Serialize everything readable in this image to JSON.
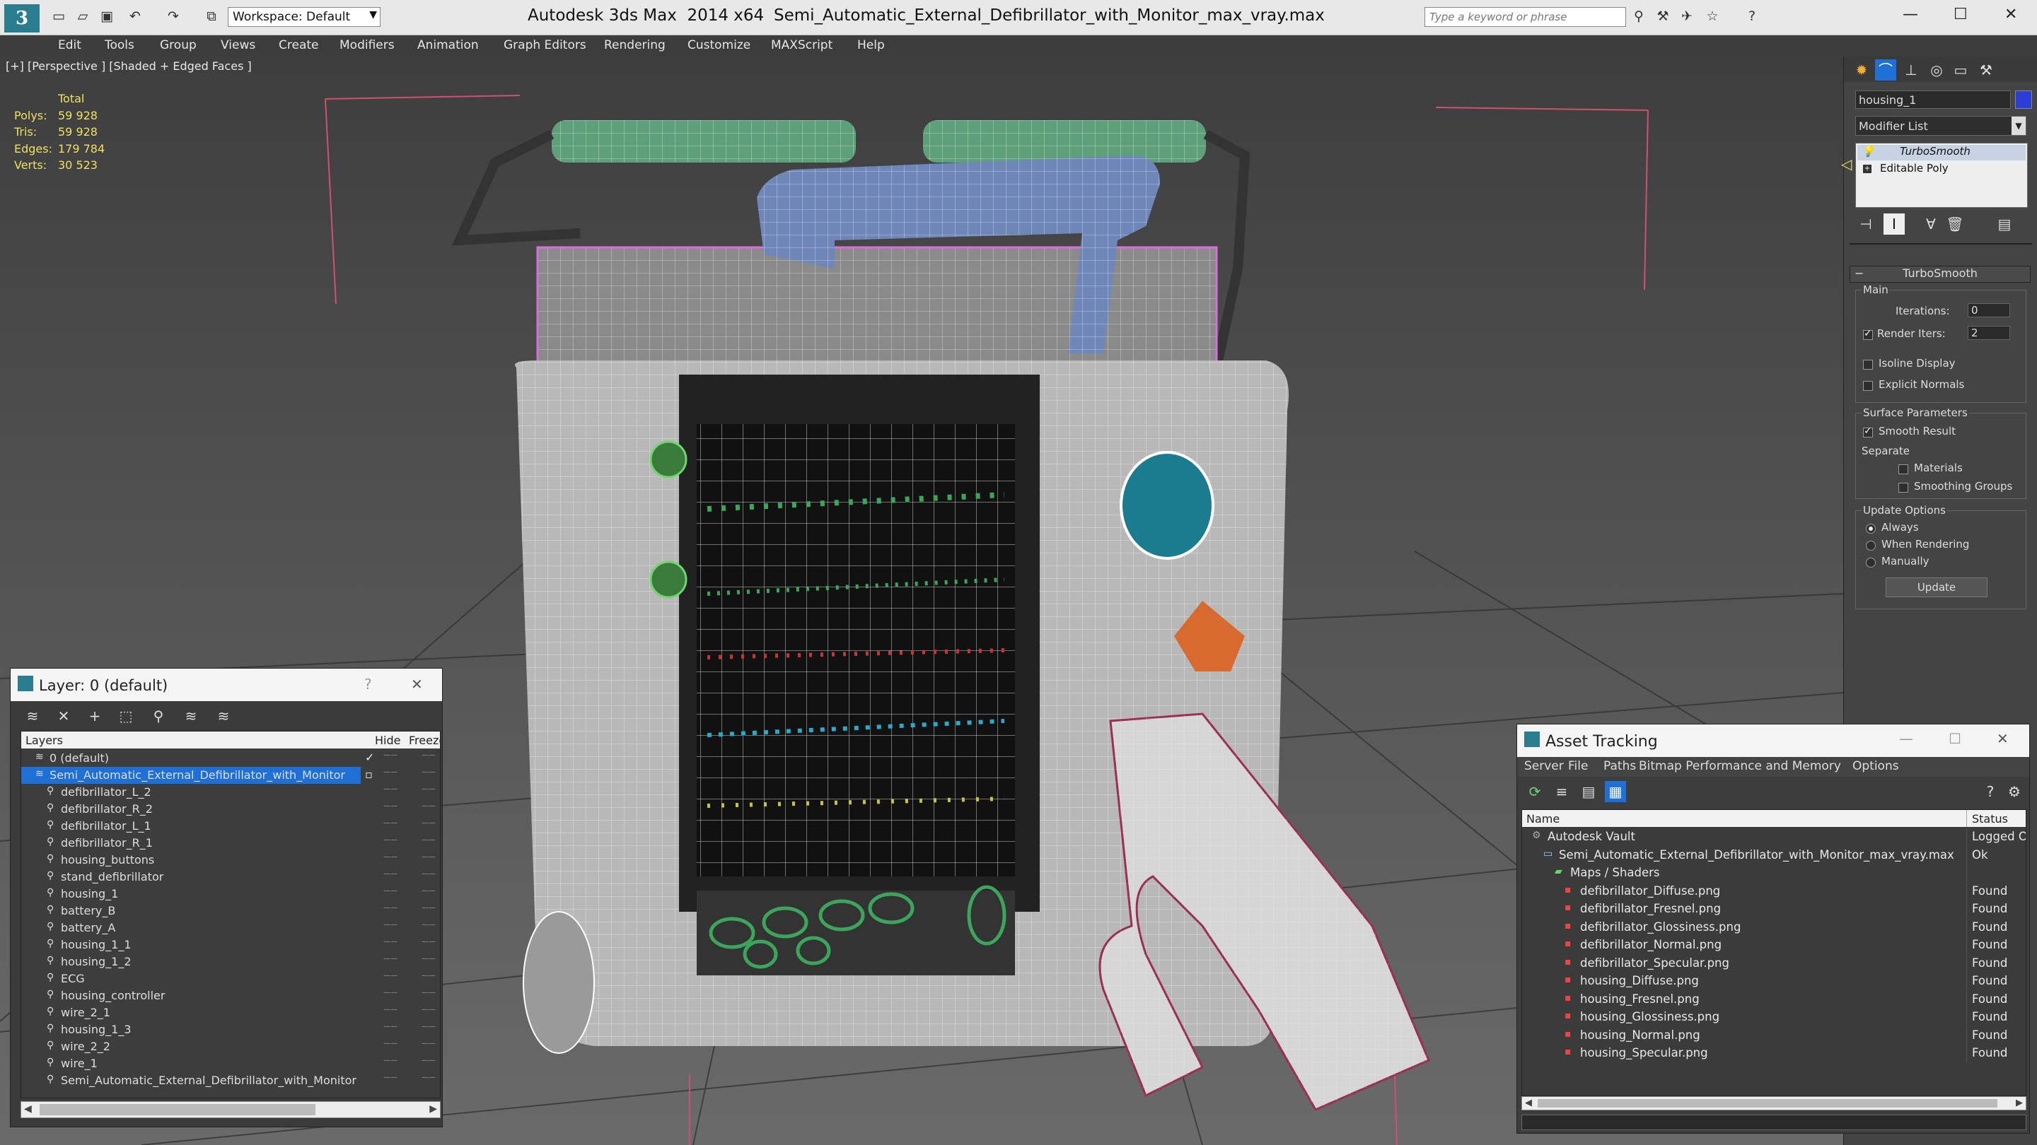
{
  "titlebar": {
    "app_title": "Autodesk 3ds Max  2014 x64",
    "file_name": "Semi_Automatic_External_Defibrillator_with_Monitor_max_vray.max",
    "workspace": "Workspace: Default",
    "search_placeholder": "Type a keyword or phrase"
  },
  "menu": [
    "Edit",
    "Tools",
    "Group",
    "Views",
    "Create",
    "Modifiers",
    "Animation",
    "Graph Editors",
    "Rendering",
    "Customize",
    "MAXScript",
    "Help"
  ],
  "viewport": {
    "label": "[+] [Perspective ] [Shaded + Edged Faces ]",
    "stats": {
      "header": "Total",
      "polys_label": "Polys:",
      "polys": "59 928",
      "tris_label": "Tris:",
      "tris": "59 928",
      "edges_label": "Edges:",
      "edges": "179 784",
      "verts_label": "Verts:",
      "verts": "30 523"
    }
  },
  "layer_panel": {
    "title": "Layer: 0 (default)",
    "help": "?",
    "close": "✕",
    "col_layers": "Layers",
    "col_hide": "Hide",
    "col_freeze": "Freeze",
    "layers": [
      {
        "name": "0 (default)",
        "level": 1
      },
      {
        "name": "Semi_Automatic_External_Defibrillator_with_Monitor",
        "level": 1
      },
      {
        "name": "defibrillator_L_2",
        "level": 2
      },
      {
        "name": "defibrillator_R_2",
        "level": 2
      },
      {
        "name": "defibrillator_L_1",
        "level": 2
      },
      {
        "name": "defibrillator_R_1",
        "level": 2
      },
      {
        "name": "housing_buttons",
        "level": 2
      },
      {
        "name": "stand_defibrillator",
        "level": 2
      },
      {
        "name": "housing_1",
        "level": 2
      },
      {
        "name": "battery_B",
        "level": 2
      },
      {
        "name": "battery_A",
        "level": 2
      },
      {
        "name": "housing_1_1",
        "level": 2
      },
      {
        "name": "housing_1_2",
        "level": 2
      },
      {
        "name": "ECG",
        "level": 2
      },
      {
        "name": "housing_controller",
        "level": 2
      },
      {
        "name": "wire_2_1",
        "level": 2
      },
      {
        "name": "housing_1_3",
        "level": 2
      },
      {
        "name": "wire_2_2",
        "level": 2
      },
      {
        "name": "wire_1",
        "level": 2
      },
      {
        "name": "Semi_Automatic_External_Defibrillator_with_Monitor",
        "level": 2
      }
    ]
  },
  "command_panel": {
    "object_name": "housing_1",
    "modifier_list": "Modifier List",
    "stack": [
      "TurboSmooth",
      "Editable Poly"
    ],
    "rollout_title": "TurboSmooth",
    "main_label": "Main",
    "iterations_label": "Iterations:",
    "iterations": "0",
    "render_iters_label": "Render Iters:",
    "render_iters": "2",
    "isoline": "Isoline Display",
    "explicit_normals": "Explicit Normals",
    "surface_params": "Surface Parameters",
    "smooth_result": "Smooth Result",
    "separate": "Separate",
    "materials": "Materials",
    "smoothing_groups": "Smoothing Groups",
    "update_options": "Update Options",
    "always": "Always",
    "when_rendering": "When Rendering",
    "manually": "Manually",
    "update_button": "Update"
  },
  "asset_tracking": {
    "title": "Asset Tracking",
    "menu": [
      "Server",
      "File",
      "Paths",
      "Bitmap Performance and Memory",
      "Options"
    ],
    "col_name": "Name",
    "col_status": "Status",
    "rows": [
      {
        "name": "Autodesk Vault",
        "status": "Logged O",
        "level": 0
      },
      {
        "name": "Semi_Automatic_External_Defibrillator_with_Monitor_max_vray.max",
        "status": "Ok",
        "level": 1
      },
      {
        "name": "Maps / Shaders",
        "status": "",
        "level": 2
      },
      {
        "name": "defibrillator_Diffuse.png",
        "status": "Found",
        "level": 3
      },
      {
        "name": "defibrillator_Fresnel.png",
        "status": "Found",
        "level": 3
      },
      {
        "name": "defibrillator_Glossiness.png",
        "status": "Found",
        "level": 3
      },
      {
        "name": "defibrillator_Normal.png",
        "status": "Found",
        "level": 3
      },
      {
        "name": "defibrillator_Specular.png",
        "status": "Found",
        "level": 3
      },
      {
        "name": "housing_Diffuse.png",
        "status": "Found",
        "level": 3
      },
      {
        "name": "housing_Fresnel.png",
        "status": "Found",
        "level": 3
      },
      {
        "name": "housing_Glossiness.png",
        "status": "Found",
        "level": 3
      },
      {
        "name": "housing_Normal.png",
        "status": "Found",
        "level": 3
      },
      {
        "name": "housing_Specular.png",
        "status": "Found",
        "level": 3
      }
    ]
  },
  "colors": {
    "accent": "#1e6fd6",
    "viewport_bg": "#5a5a5a",
    "panel_bg": "#3b3b3b"
  }
}
